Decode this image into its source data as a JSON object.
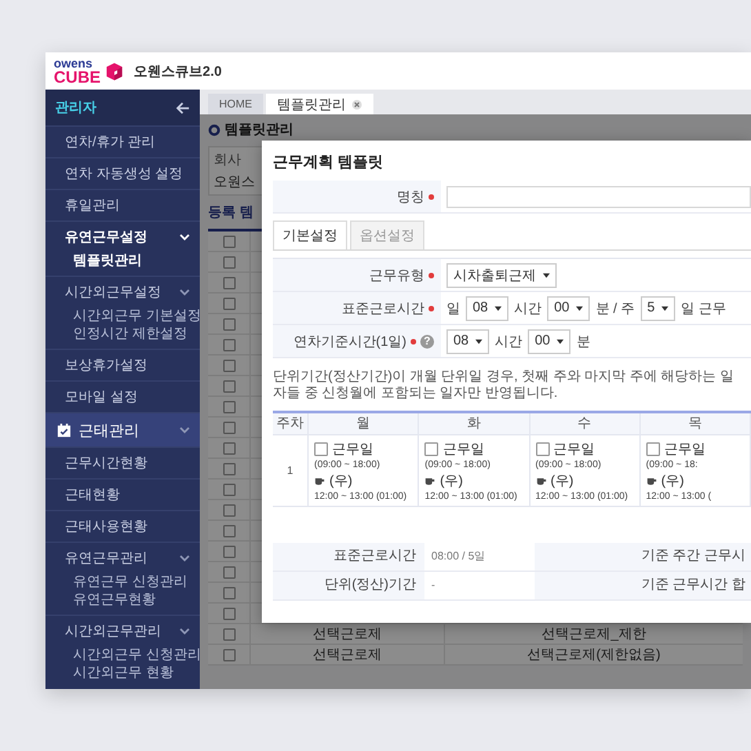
{
  "header": {
    "logo_top": "owens",
    "logo_bottom": "CUBE",
    "app_title": "오웬스큐브2.0"
  },
  "sidebar": {
    "title": "관리자",
    "items": [
      {
        "label": "연차/휴가 관리",
        "kind": "item",
        "selected": false
      },
      {
        "label": "연차 자동생성 설정",
        "kind": "item",
        "selected": false
      },
      {
        "label": "휴일관리",
        "kind": "item",
        "selected": false
      },
      {
        "label": "유연근무설정",
        "kind": "group",
        "selected": true,
        "children": [
          {
            "label": "템플릿관리",
            "selected": true
          }
        ]
      },
      {
        "label": "시간외근무설정",
        "kind": "group",
        "selected": false,
        "children": [
          {
            "label": "시간외근무 기본설정",
            "selected": false
          },
          {
            "label": "인정시간 제한설정",
            "selected": false
          }
        ]
      },
      {
        "label": "보상휴가설정",
        "kind": "item",
        "selected": false
      },
      {
        "label": "모바일 설정",
        "kind": "item",
        "selected": false
      },
      {
        "label": "근태관리",
        "kind": "section",
        "selected": false
      },
      {
        "label": "근무시간현황",
        "kind": "item",
        "selected": false
      },
      {
        "label": "근태현황",
        "kind": "item",
        "selected": false
      },
      {
        "label": "근태사용현황",
        "kind": "item",
        "selected": false
      },
      {
        "label": "유연근무관리",
        "kind": "group",
        "selected": false,
        "children": [
          {
            "label": "유연근무 신청관리",
            "selected": false
          },
          {
            "label": "유연근무현황",
            "selected": false
          }
        ]
      },
      {
        "label": "시간외근무관리",
        "kind": "group",
        "selected": false,
        "children": [
          {
            "label": "시간외근무 신청관리",
            "selected": false
          },
          {
            "label": "시간외근무 현황",
            "selected": false
          }
        ]
      }
    ]
  },
  "tabs": [
    {
      "label": "HOME",
      "selected": false,
      "closable": false
    },
    {
      "label": "템플릿관리",
      "selected": true,
      "closable": true
    }
  ],
  "page_title": "템플릿관리",
  "filter": {
    "label": "회사",
    "value": "오원스"
  },
  "section_title": "등록 템",
  "table": {
    "rows": [
      {
        "checked": false
      },
      {
        "checked": false
      },
      {
        "checked": false
      },
      {
        "checked": false
      },
      {
        "checked": false
      },
      {
        "checked": false
      },
      {
        "checked": false
      },
      {
        "checked": false
      },
      {
        "checked": false
      },
      {
        "checked": false
      },
      {
        "checked": false
      },
      {
        "checked": false
      },
      {
        "checked": false
      },
      {
        "checked": false
      },
      {
        "checked": false
      },
      {
        "checked": false
      },
      {
        "checked": false
      },
      {
        "checked": false
      },
      {
        "checked": false
      },
      {
        "checked": false,
        "column_1": "선택근로제",
        "column_2": "선택근로제_제한"
      },
      {
        "checked": false,
        "column_1": "선택근로제",
        "column_2": "선택근로제(제한없음)"
      }
    ]
  },
  "dialog": {
    "title": "근무계획 템플릿",
    "name_field": {
      "label": "명칭",
      "required": true
    },
    "tabs": [
      {
        "label": "기본설정",
        "selected": true
      },
      {
        "label": "옵션설정",
        "selected": false
      }
    ],
    "form": [
      {
        "label": "근무유형",
        "required": true,
        "parts": [
          {
            "kind": "select",
            "value": "시차출퇴근제"
          }
        ]
      },
      {
        "label": "표준근로시간",
        "required": true,
        "parts": [
          {
            "kind": "text",
            "value": "일"
          },
          {
            "kind": "select",
            "value": "08"
          },
          {
            "kind": "text",
            "value": "시간"
          },
          {
            "kind": "select",
            "value": "00"
          },
          {
            "kind": "text",
            "value": "분 / 주"
          },
          {
            "kind": "select",
            "value": "5"
          },
          {
            "kind": "text",
            "value": "일 근무"
          }
        ]
      },
      {
        "label": "연차기준시간(1일)",
        "required": true,
        "help": "?",
        "parts": [
          {
            "kind": "select",
            "value": "08"
          },
          {
            "kind": "text",
            "value": "시간"
          },
          {
            "kind": "select",
            "value": "00"
          },
          {
            "kind": "text",
            "value": "분"
          }
        ]
      }
    ],
    "notice": "단위기간(정산기간)이 개월 단위일 경우, 첫째 주와 마지막 주에 해당하는 일자들 중 신청월에 포함되는 일자만 반영됩니다.",
    "schedule": {
      "columns": [
        "주차",
        "월",
        "화",
        "수",
        "목"
      ],
      "rows": [
        {
          "week": "1",
          "days": [
            {
              "checked": false,
              "label": "근무일",
              "hours": "(09:00 ~ 18:00)",
              "break_label": "(우)",
              "break_hours": "12:00 ~ 13:00 (01:00)"
            },
            {
              "checked": false,
              "label": "근무일",
              "hours": "(09:00 ~ 18:00)",
              "break_label": "(우)",
              "break_hours": "12:00 ~ 13:00 (01:00)"
            },
            {
              "checked": false,
              "label": "근무일",
              "hours": "(09:00 ~ 18:00)",
              "break_label": "(우)",
              "break_hours": "12:00 ~ 13:00 (01:00)"
            },
            {
              "checked": false,
              "label": "근무일",
              "hours": "(09:00 ~ 18:",
              "break_label": "(우)",
              "break_hours": "12:00 ~ 13:00 ("
            }
          ]
        }
      ]
    },
    "summary": [
      {
        "label": "표준근로시간",
        "value": "08:00 / 5일",
        "label_2": "기준 주간 근무시"
      },
      {
        "label": "단위(정산)기간",
        "value": "-",
        "label_2": "기준 근무시간 합"
      }
    ]
  }
}
